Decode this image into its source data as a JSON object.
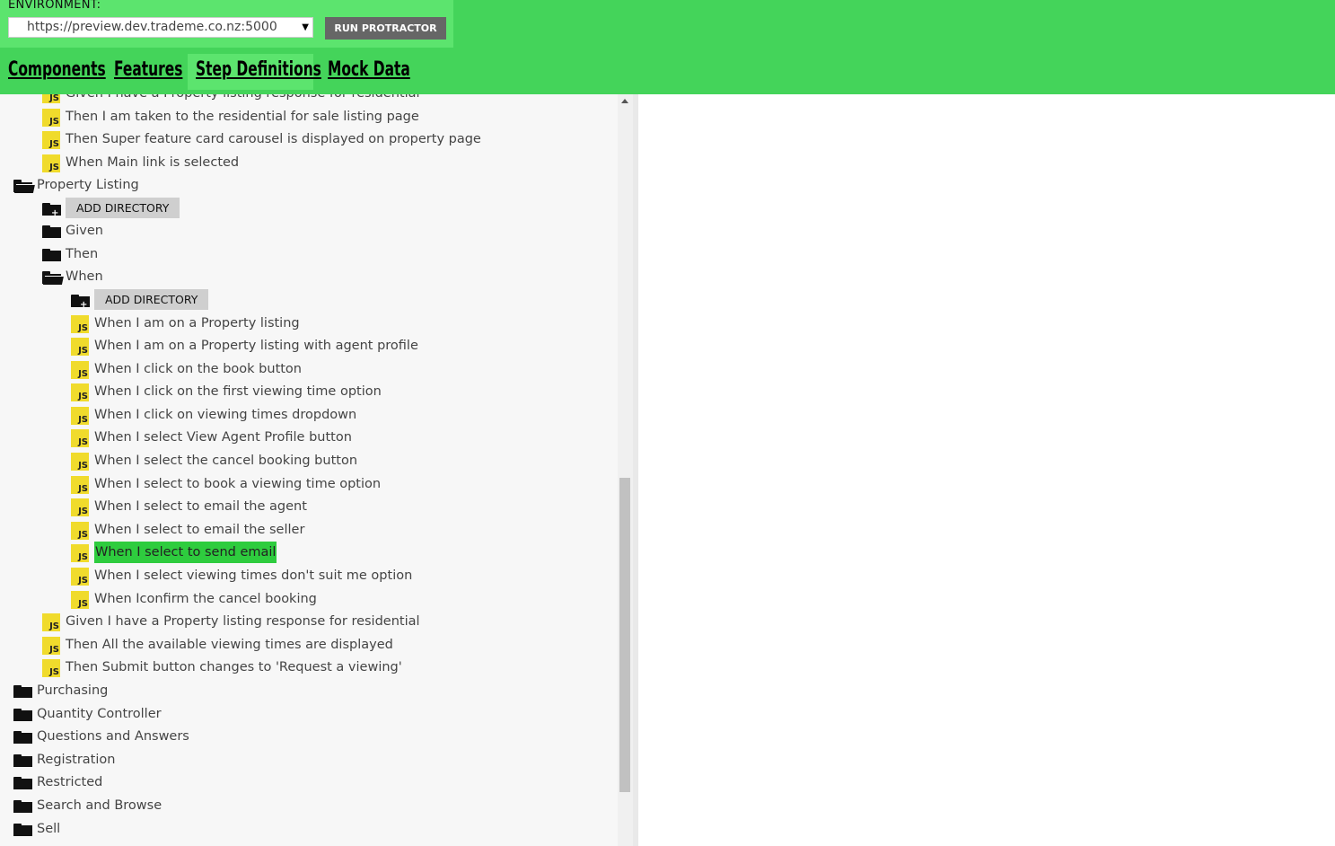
{
  "environment": {
    "label": "ENVIRONMENT:",
    "selected": "https://preview.dev.trademe.co.nz:5000",
    "run_button": "RUN PROTRACTOR"
  },
  "tabs": [
    "Components",
    "Features",
    "Step Definitions",
    "Mock Data"
  ],
  "active_tab": "Step Definitions",
  "tree": {
    "r0": "Given I have a Property listing response for residential",
    "r1": "Then I am taken to the residential for sale listing page",
    "r2": "Then Super feature card carousel is displayed on property page",
    "r3": "When Main link is selected",
    "r4": "Property Listing",
    "r5": "ADD DIRECTORY",
    "r6": "Given",
    "r7": "Then",
    "r8": "When",
    "r9": "ADD DIRECTORY",
    "r10": "When I am on a Property listing",
    "r11": "When I am on a Property listing with agent profile",
    "r12": "When I click on the book button",
    "r13": "When I click on the first viewing time option",
    "r14": "When I click on viewing times dropdown",
    "r15": "When I select View Agent Profile button",
    "r16": "When I select the cancel booking button",
    "r17": "When I select to book a viewing time option",
    "r18": "When I select to email the agent",
    "r19": "When I select to email the seller",
    "r20": "When I select to send email",
    "r21": "When I select viewing times don't suit me option",
    "r22": "When Iconfirm the cancel booking",
    "r23": "Given I have a Property listing response for residential",
    "r24": "Then All the available viewing times are displayed",
    "r25": "Then Submit button changes to 'Request a viewing'",
    "r26": "Purchasing",
    "r27": "Quantity Controller",
    "r28": "Questions and Answers",
    "r29": "Registration",
    "r30": "Restricted",
    "r31": "Search and Browse",
    "r32": "Sell"
  },
  "js_badge": "JS",
  "colors": {
    "header": "#44d45a",
    "highlight": "#2ecc3e",
    "js": "#f0db2c"
  }
}
